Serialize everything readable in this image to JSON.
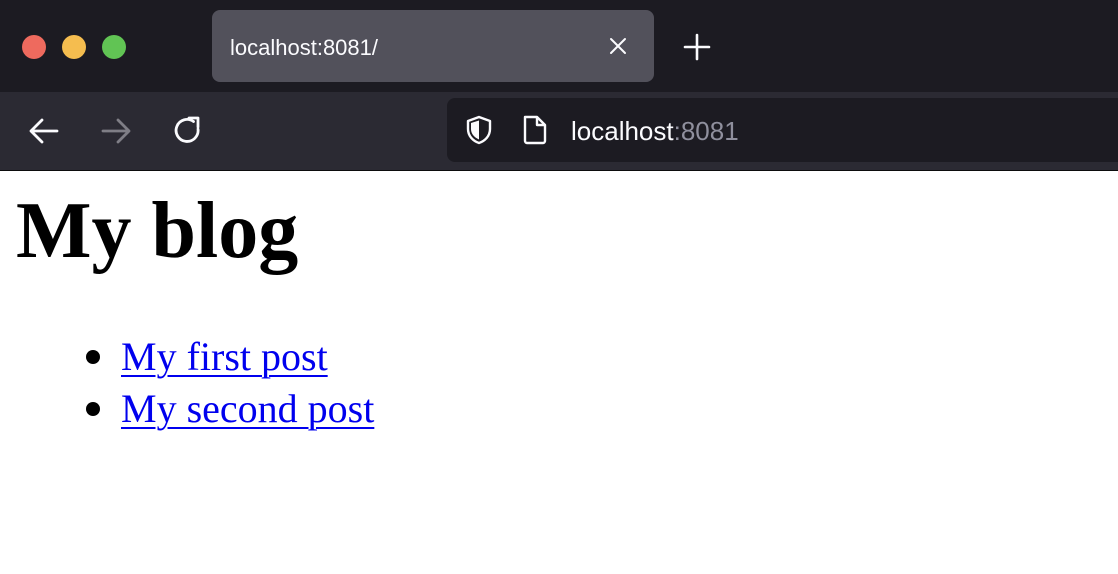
{
  "browser": {
    "tab": {
      "title": "localhost:8081/"
    },
    "urlbar": {
      "host": "localhost",
      "port": ":8081"
    },
    "icons": {
      "close": "close-icon",
      "new_tab": "plus-icon",
      "back": "back-arrow-icon",
      "forward": "forward-arrow-icon",
      "reload": "reload-icon",
      "shield": "shield-icon",
      "page": "page-icon"
    },
    "colors": {
      "tabstrip": "#1c1b22",
      "toolbar": "#2b2a33",
      "active_tab": "#52515b",
      "traffic_red": "#ee6a5e",
      "traffic_yellow": "#f5bd4f",
      "traffic_green": "#61c454"
    }
  },
  "page": {
    "title": "My blog",
    "posts": [
      {
        "label": "My first post"
      },
      {
        "label": "My second post"
      }
    ],
    "colors": {
      "link": "#0000ee"
    }
  }
}
